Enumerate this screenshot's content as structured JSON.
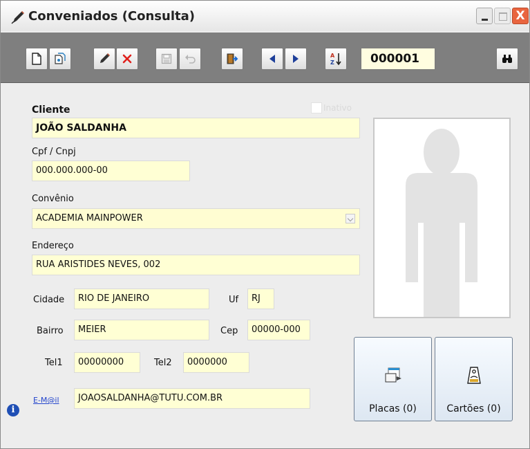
{
  "window": {
    "title": "Conveniados (Consulta)",
    "close_symbol": "X"
  },
  "toolbar": {
    "record_code": "000001"
  },
  "form": {
    "cliente_label": "Cliente",
    "cliente_value": "JOÃO SALDANHA",
    "inativo_label": "Inativo",
    "cpf_label": "Cpf / Cnpj",
    "cpf_value": "000.000.000-00",
    "convenio_label": "Convênio",
    "convenio_value": "ACADEMIA MAINPOWER",
    "endereco_label": "Endereço",
    "endereco_value": "RUA ARISTIDES NEVES, 002",
    "cidade_label": "Cidade",
    "cidade_value": "RIO DE JANEIRO",
    "uf_label": "Uf",
    "uf_value": "RJ",
    "bairro_label": "Bairro",
    "bairro_value": "MEIER",
    "cep_label": "Cep",
    "cep_value": "00000-000",
    "tel1_label": "Tel1",
    "tel1_value": "00000000",
    "tel2_label": "Tel2",
    "tel2_value": "0000000",
    "email_label": "E-M@il",
    "email_value": "JOAOSALDANHA@TUTU.COM.BR",
    "info_symbol": "i"
  },
  "side": {
    "placas_label": "Placas (0)",
    "cartoes_label": "Cartões (0)"
  }
}
